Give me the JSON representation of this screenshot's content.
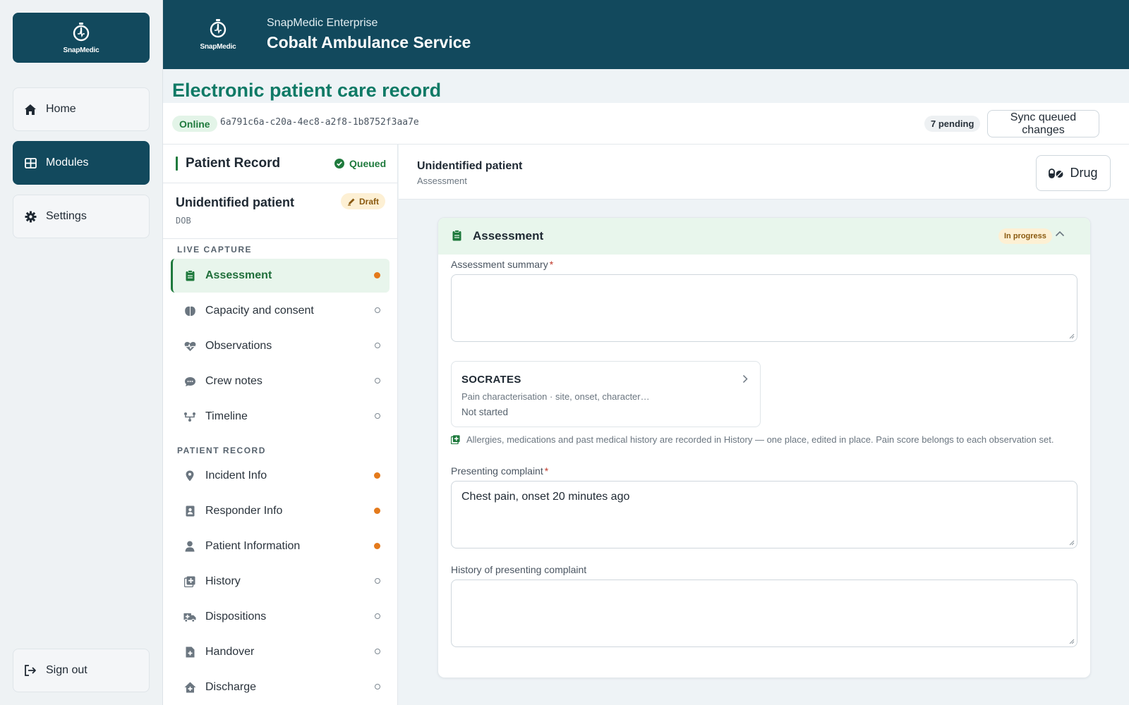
{
  "brand": {
    "logo_text": "SnapMedic"
  },
  "nav": {
    "home": "Home",
    "modules": "Modules",
    "settings": "Settings",
    "sign_out": "Sign out"
  },
  "header": {
    "eyebrow": "SnapMedic Enterprise",
    "title": "Cobalt Ambulance Service"
  },
  "page": {
    "title": "Electronic patient care record"
  },
  "status": {
    "online": "Online",
    "record_id": "6a791c6a-c20a-4ec8-a2f8-1b8752f3aa7e",
    "pending": "7 pending",
    "sync_label": "Sync queued changes"
  },
  "record_panel": {
    "title": "Patient Record",
    "queued": "Queued",
    "patient_name": "Unidentified patient",
    "dob_label": "DOB",
    "draft": "Draft",
    "live_capture_label": "LIVE CAPTURE",
    "live_capture": [
      {
        "label": "Assessment",
        "icon": "clipboard-icon",
        "status": "in-progress"
      },
      {
        "label": "Capacity and consent",
        "icon": "brain-icon",
        "status": "empty"
      },
      {
        "label": "Observations",
        "icon": "heart-pulse-icon",
        "status": "empty"
      },
      {
        "label": "Crew notes",
        "icon": "chat-icon",
        "status": "empty"
      },
      {
        "label": "Timeline",
        "icon": "timeline-icon",
        "status": "empty"
      }
    ],
    "patient_record_label": "PATIENT RECORD",
    "patient_record": [
      {
        "label": "Incident Info",
        "icon": "location-pin-icon",
        "status": "in-progress"
      },
      {
        "label": "Responder Info",
        "icon": "id-badge-icon",
        "status": "in-progress"
      },
      {
        "label": "Patient Information",
        "icon": "person-icon",
        "status": "in-progress"
      },
      {
        "label": "History",
        "icon": "medical-history-icon",
        "status": "empty"
      },
      {
        "label": "Dispositions",
        "icon": "ambulance-icon",
        "status": "empty"
      },
      {
        "label": "Handover",
        "icon": "file-medical-icon",
        "status": "empty"
      },
      {
        "label": "Discharge",
        "icon": "house-medical-icon",
        "status": "empty"
      }
    ]
  },
  "main": {
    "patient_name": "Unidentified patient",
    "section": "Assessment",
    "drug_button": "Drug",
    "card": {
      "title": "Assessment",
      "status": "In progress",
      "assessment_summary_label": "Assessment summary",
      "assessment_summary_value": "",
      "socrates_title": "SOCRATES",
      "socrates_desc": "Pain characterisation · site, onset, character…",
      "socrates_status": "Not started",
      "note": "Allergies, medications and past medical history are recorded in History — one place, edited in place. Pain score belongs to each observation set.",
      "presenting_complaint_label": "Presenting complaint",
      "presenting_complaint_value": "Chest pain, onset 20 minutes ago",
      "hpc_label": "History of presenting complaint",
      "hpc_value": ""
    }
  },
  "colors": {
    "brand": "#12495d",
    "accent_green": "#0f7a66",
    "status_green": "#1f7a3d",
    "pending_orange": "#e47a1c"
  }
}
